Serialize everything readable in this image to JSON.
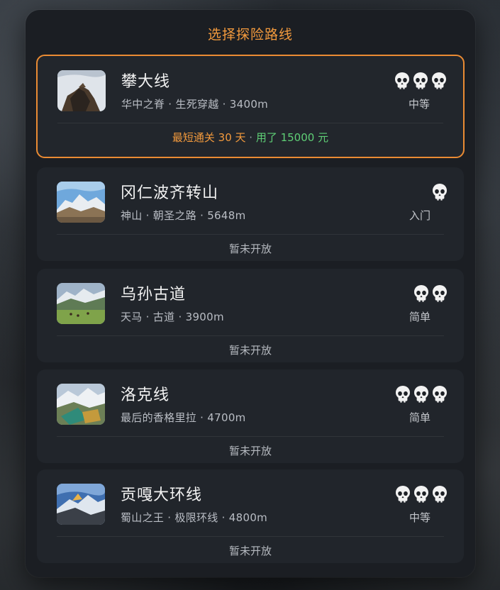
{
  "title": "选择探险路线",
  "colors": {
    "accent": "#f39a3d",
    "success": "#5fcf76",
    "card": "#21252b"
  },
  "routes": [
    {
      "name": "攀大线",
      "subtitle": "华中之脊 · 生死穿越 · 3400m",
      "difficulty_skulls": 3,
      "difficulty_label": "中等",
      "selected": true,
      "record": {
        "best": "最短通关 30 天",
        "sep": " · ",
        "cost": "用了 15000 元"
      }
    },
    {
      "name": "冈仁波齐转山",
      "subtitle": "神山 · 朝圣之路 · 5648m",
      "difficulty_skulls": 1,
      "difficulty_label": "入门",
      "status": "暂未开放"
    },
    {
      "name": "乌孙古道",
      "subtitle": "天马 · 古道 · 3900m",
      "difficulty_skulls": 2,
      "difficulty_label": "简单",
      "status": "暂未开放"
    },
    {
      "name": "洛克线",
      "subtitle": "最后的香格里拉 · 4700m",
      "difficulty_skulls": 3,
      "difficulty_label": "简单",
      "status": "暂未开放"
    },
    {
      "name": "贡嘎大环线",
      "subtitle": "蜀山之王 · 极限环线 · 4800m",
      "difficulty_skulls": 3,
      "difficulty_label": "中等",
      "status": "暂未开放"
    }
  ]
}
